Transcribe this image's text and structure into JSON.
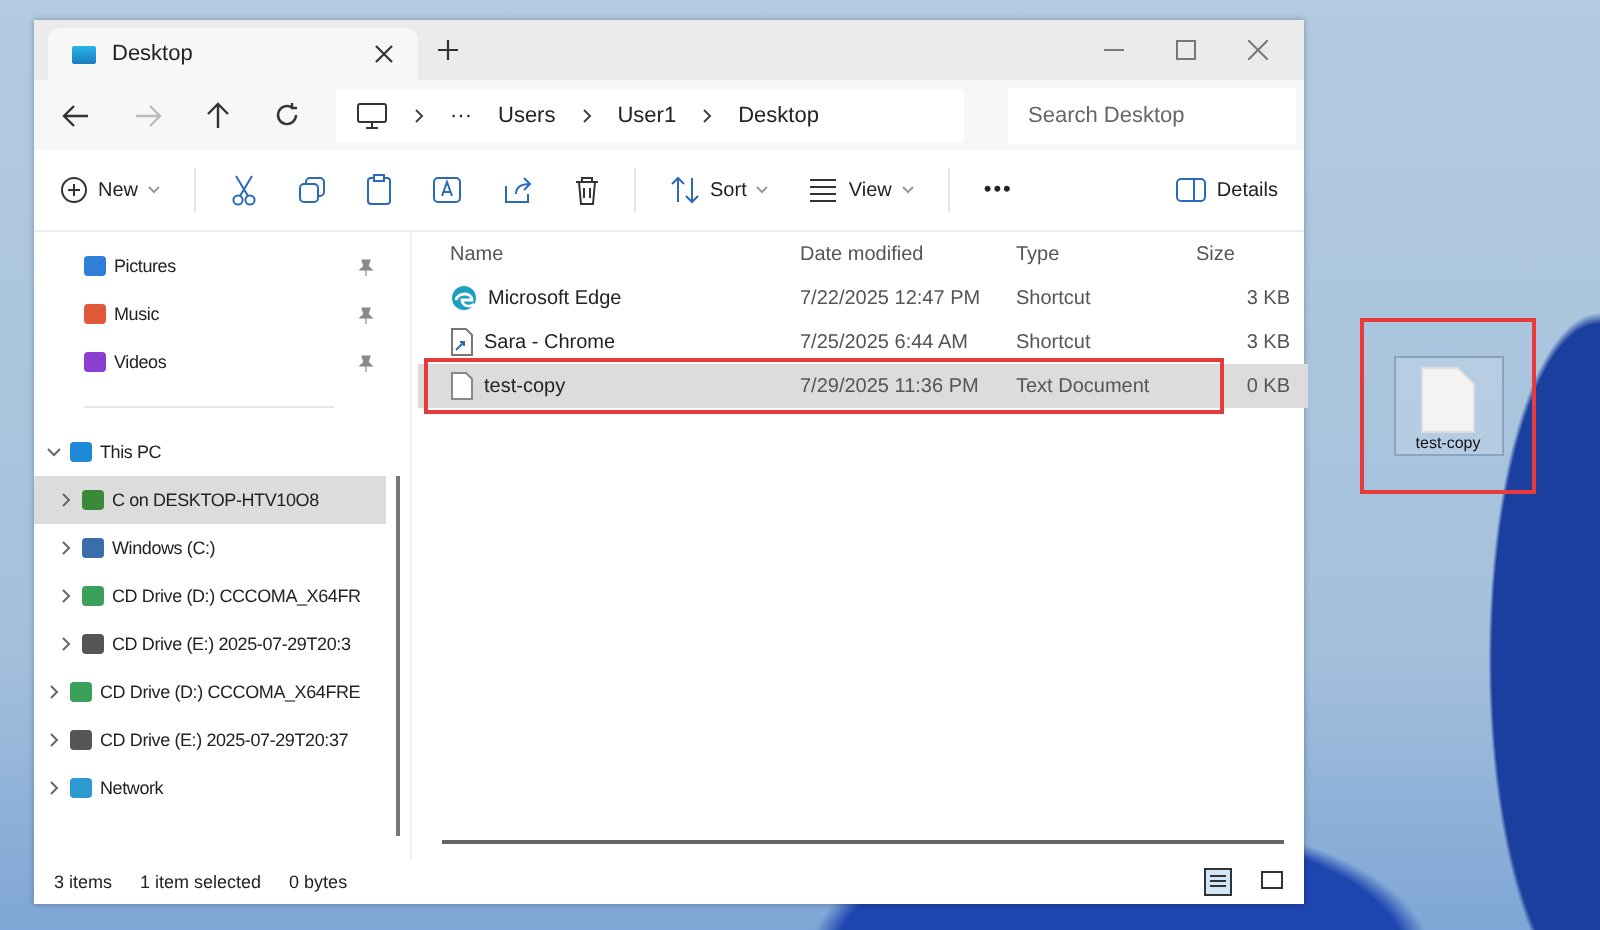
{
  "window": {
    "tab_title": "Desktop"
  },
  "address": {
    "crumbs": [
      "Users",
      "User1",
      "Desktop"
    ],
    "ellipsis": "···"
  },
  "search": {
    "placeholder": "Search Desktop"
  },
  "toolbar": {
    "new": "New",
    "sort": "Sort",
    "view": "View",
    "more": "•••",
    "details": "Details"
  },
  "sidebar": {
    "items": [
      {
        "label": "Pictures",
        "pinned": true,
        "selected": false
      },
      {
        "label": "Music",
        "pinned": true,
        "selected": false
      },
      {
        "label": "Videos",
        "pinned": true,
        "selected": false
      },
      {
        "kind": "divider"
      },
      {
        "label": "This PC",
        "expanded": true,
        "selected": false,
        "children": [
          {
            "label": "C on DESKTOP-HTV10O8",
            "expanded": false,
            "selected": true
          },
          {
            "label": "Windows (C:)",
            "expanded": false,
            "selected": false
          },
          {
            "label": "CD Drive (D:) CCCOMA_X64FR",
            "expanded": false,
            "selected": false
          },
          {
            "label": "CD Drive (E:) 2025-07-29T20:3",
            "expanded": false,
            "selected": false
          }
        ]
      },
      {
        "label": "CD Drive (D:) CCCOMA_X64FRE",
        "expanded": false,
        "selected": false
      },
      {
        "label": "CD Drive (E:) 2025-07-29T20:37",
        "expanded": false,
        "selected": false
      },
      {
        "label": "Network",
        "expanded": false,
        "selected": false
      }
    ]
  },
  "table": {
    "columns": [
      "Name",
      "Date modified",
      "Type",
      "Size"
    ],
    "rows": [
      {
        "name": "Microsoft Edge",
        "date": "7/22/2025 12:47 PM",
        "type": "Shortcut",
        "size": "3 KB",
        "selected": false,
        "outlined": false
      },
      {
        "name": "Sara - Chrome",
        "date": "7/25/2025 6:44 AM",
        "type": "Shortcut",
        "size": "3 KB",
        "selected": false,
        "outlined": false
      },
      {
        "name": "test-copy",
        "date": "7/29/2025 11:36 PM",
        "type": "Text Document",
        "size": "0 KB",
        "selected": true,
        "outlined": true
      }
    ]
  },
  "status_bar": {
    "count": "3 items",
    "selection": "1 item selected",
    "bytes": "0 bytes"
  },
  "desktop_icon": {
    "label": "test-copy",
    "outlined": true
  }
}
